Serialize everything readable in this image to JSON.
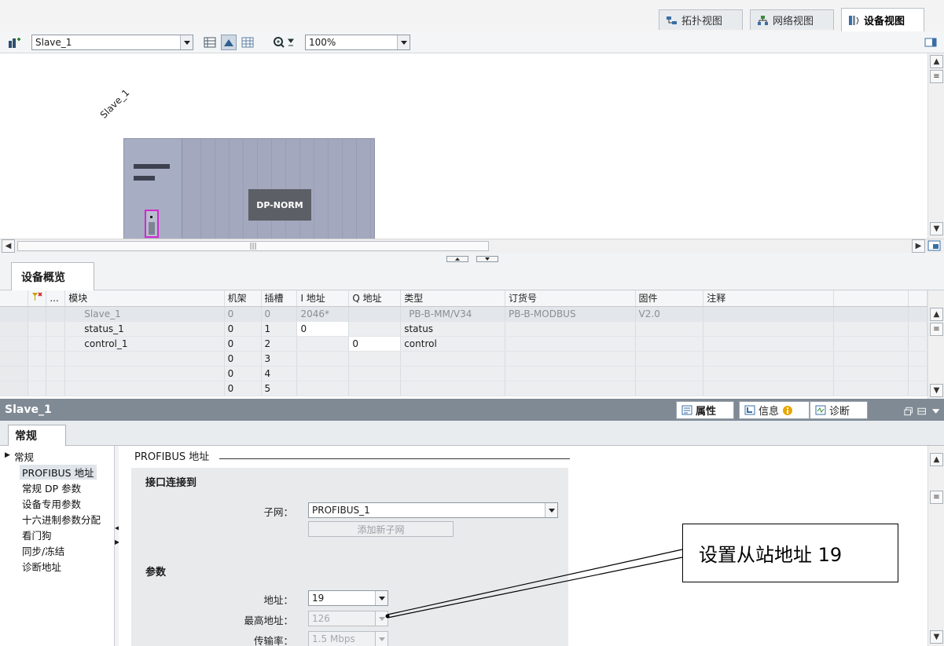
{
  "view_tabs": [
    {
      "label": "拓扑视图",
      "icon": "topology-icon"
    },
    {
      "label": "网络视图",
      "icon": "network-icon"
    },
    {
      "label": "设备视图",
      "icon": "device-icon"
    }
  ],
  "toolbar": {
    "device_select": "Slave_1",
    "zoom": "100%"
  },
  "device": {
    "name_tag": "Slave_1",
    "module_label": "DP-NORM"
  },
  "overview": {
    "tab_label": "设备概览",
    "columns": [
      "",
      "...",
      "模块",
      "机架",
      "插槽",
      "I 地址",
      "Q 地址",
      "类型",
      "订货号",
      "固件",
      "注释"
    ],
    "rows": [
      {
        "module": "Slave_1",
        "rack": "0",
        "slot": "0",
        "i_addr": "2046*",
        "q_addr": "",
        "type": "PB-B-MM/V34",
        "order": "PB-B-MODBUS",
        "firmware": "V2.0",
        "comment": ""
      },
      {
        "module": "status_1",
        "rack": "0",
        "slot": "1",
        "i_addr": "0",
        "q_addr": "",
        "type": "status",
        "order": "",
        "firmware": "",
        "comment": ""
      },
      {
        "module": "control_1",
        "rack": "0",
        "slot": "2",
        "i_addr": "",
        "q_addr": "0",
        "type": "control",
        "order": "",
        "firmware": "",
        "comment": ""
      },
      {
        "module": "",
        "rack": "0",
        "slot": "3",
        "i_addr": "",
        "q_addr": "",
        "type": "",
        "order": "",
        "firmware": "",
        "comment": ""
      },
      {
        "module": "",
        "rack": "0",
        "slot": "4",
        "i_addr": "",
        "q_addr": "",
        "type": "",
        "order": "",
        "firmware": "",
        "comment": ""
      },
      {
        "module": "",
        "rack": "0",
        "slot": "5",
        "i_addr": "",
        "q_addr": "",
        "type": "",
        "order": "",
        "firmware": "",
        "comment": ""
      }
    ]
  },
  "properties": {
    "title": "Slave_1",
    "tabs": [
      "属性",
      "信息",
      "诊断"
    ],
    "general_tab": "常规",
    "nav": [
      "常规",
      "PROFIBUS 地址",
      "常规 DP 参数",
      "设备专用参数",
      "十六进制参数分配",
      "看门狗",
      "同步/冻结",
      "诊断地址"
    ],
    "section_title": "PROFIBUS 地址",
    "interface_heading": "接口连接到",
    "subnet_label": "子网：",
    "subnet_value": "PROFIBUS_1",
    "add_subnet_button": "添加新子网",
    "params_heading": "参数",
    "address_label": "地址：",
    "address_value": "19",
    "max_address_label": "最高地址：",
    "max_address_value": "126",
    "baud_label": "传输率：",
    "baud_value": "1.5 Mbps"
  },
  "annotation": {
    "callout_text": "设置从站地址 19"
  }
}
